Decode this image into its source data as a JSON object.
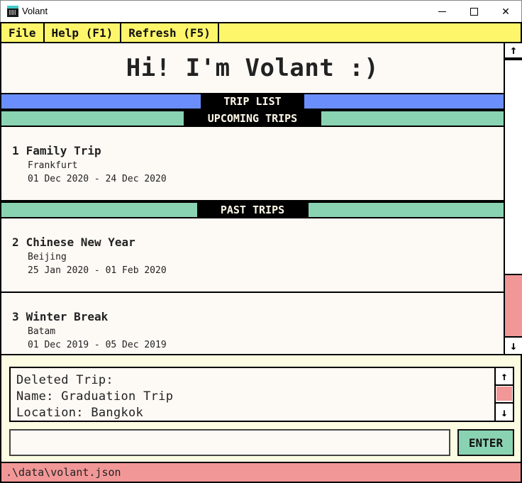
{
  "window": {
    "title": "Volant",
    "controls": {
      "minimize": "minimize",
      "maximize": "maximize",
      "close": "✕"
    }
  },
  "menu": {
    "items": [
      {
        "label": "File"
      },
      {
        "label": "Help (F1)"
      },
      {
        "label": "Refresh (F5)"
      }
    ]
  },
  "header": {
    "greeting": "Hi! I'm Volant :)"
  },
  "sections": {
    "trip_list": "TRIP LIST",
    "upcoming": "UPCOMING TRIPS",
    "past": "PAST TRIPS"
  },
  "trips": {
    "upcoming": [
      {
        "index": "1",
        "name": "Family Trip",
        "location": "Frankfurt",
        "dates": "01 Dec 2020 - 24 Dec 2020"
      }
    ],
    "past": [
      {
        "index": "2",
        "name": "Chinese New Year",
        "location": "Beijing",
        "dates": "25 Jan 2020 - 01 Feb 2020"
      },
      {
        "index": "3",
        "name": "Winter Break",
        "location": "Batam",
        "dates": "01 Dec 2019 - 05 Dec 2019"
      }
    ]
  },
  "scrollbars": {
    "up_glyph": "↑",
    "down_glyph": "↓",
    "main_scroll_position": 1.0,
    "result_scroll_position": 0.5
  },
  "result": {
    "text": "Deleted Trip:\nName: Graduation Trip\nLocation: Bangkok"
  },
  "command": {
    "value": "",
    "placeholder": "",
    "enter_label": "ENTER"
  },
  "status": {
    "path": ".\\data\\volant.json"
  },
  "colors": {
    "menu_bg": "#fef66a",
    "trip_list_banner": "#6a8ffd",
    "section_banner": "#8ad3b2",
    "scroll_thumb": "#f29797",
    "status_bg": "#f29797",
    "bottom_bg": "#fbfce1",
    "content_bg": "#fdfaf5",
    "enter_button": "#8ad3b2"
  }
}
